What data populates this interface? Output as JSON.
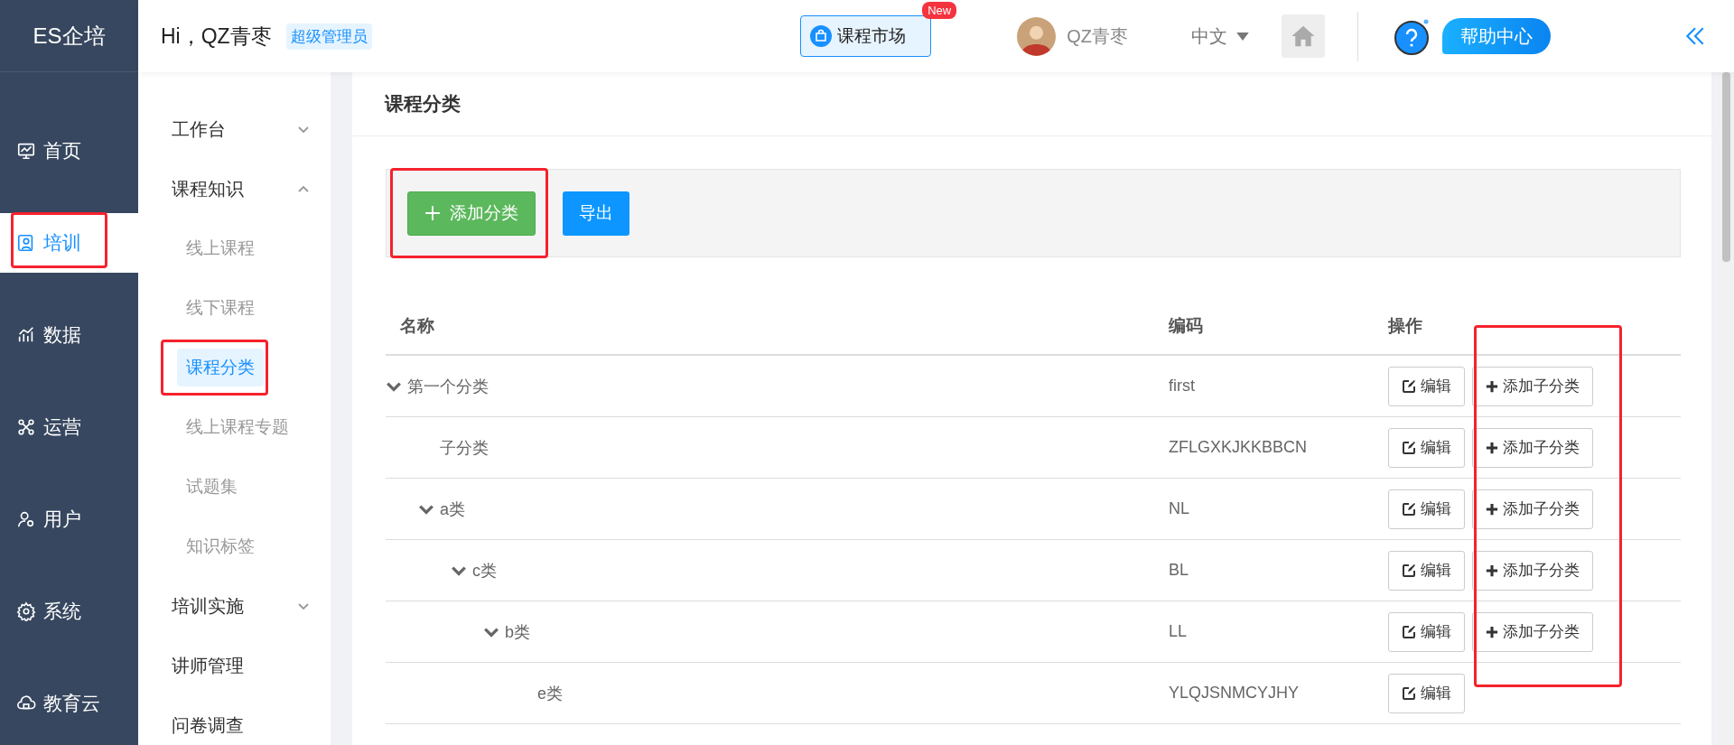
{
  "logo": "ES企培",
  "nav": [
    {
      "label": "首页",
      "selected": false,
      "highlighted": false
    },
    {
      "label": "培训",
      "selected": true,
      "highlighted": true
    },
    {
      "label": "数据",
      "selected": false,
      "highlighted": false
    },
    {
      "label": "运营",
      "selected": false,
      "highlighted": false
    },
    {
      "label": "用户",
      "selected": false,
      "highlighted": false
    },
    {
      "label": "系统",
      "selected": false,
      "highlighted": false
    },
    {
      "label": "教育云",
      "selected": false,
      "highlighted": false
    }
  ],
  "header": {
    "greeting": "Hi，QZ青枣",
    "role_badge": "超级管理员",
    "market_button": "课程市场",
    "new_badge": "New",
    "user_name": "QZ青枣",
    "language": "中文",
    "help_button": "帮助中心"
  },
  "submenu": [
    {
      "label": "工作台",
      "expandable": true,
      "expanded": false
    },
    {
      "label": "课程知识",
      "expandable": true,
      "expanded": true,
      "children": [
        {
          "label": "线上课程",
          "selected": false,
          "highlighted": false
        },
        {
          "label": "线下课程",
          "selected": false,
          "highlighted": false
        },
        {
          "label": "课程分类",
          "selected": true,
          "highlighted": true
        },
        {
          "label": "线上课程专题",
          "selected": false,
          "highlighted": false
        },
        {
          "label": "试题集",
          "selected": false,
          "highlighted": false
        },
        {
          "label": "知识标签",
          "selected": false,
          "highlighted": false
        }
      ]
    },
    {
      "label": "培训实施",
      "expandable": true,
      "expanded": false
    },
    {
      "label": "讲师管理",
      "expandable": false
    },
    {
      "label": "问卷调查",
      "expandable": false
    }
  ],
  "page_title": "课程分类",
  "toolbar": {
    "add_button": {
      "label": "添加分类",
      "highlighted": true
    },
    "export_button": "导出"
  },
  "table": {
    "columns": [
      "名称",
      "编码",
      "操作"
    ],
    "actions_highlighted": true,
    "rows": [
      {
        "name": "第一个分类",
        "code": "first",
        "expanded": true,
        "actions": [
          {
            "kind": "edit",
            "label": "编辑"
          },
          {
            "kind": "add",
            "label": "添加子分类"
          }
        ],
        "children": [
          {
            "name": "子分类",
            "code": "ZFLGXKJKKBBCN",
            "actions": [
              {
                "kind": "edit",
                "label": "编辑"
              },
              {
                "kind": "add",
                "label": "添加子分类"
              }
            ]
          },
          {
            "name": "a类",
            "code": "NL",
            "expanded": true,
            "actions": [
              {
                "kind": "edit",
                "label": "编辑"
              },
              {
                "kind": "add",
                "label": "添加子分类"
              }
            ],
            "children": [
              {
                "name": "c类",
                "code": "BL",
                "expanded": true,
                "actions": [
                  {
                    "kind": "edit",
                    "label": "编辑"
                  },
                  {
                    "kind": "add",
                    "label": "添加子分类"
                  }
                ],
                "children": [
                  {
                    "name": "b类",
                    "code": "LL",
                    "expanded": true,
                    "actions": [
                      {
                        "kind": "edit",
                        "label": "编辑"
                      },
                      {
                        "kind": "add",
                        "label": "添加子分类"
                      }
                    ],
                    "children": [
                      {
                        "name": "e类",
                        "code": "YLQJSNMCYJHY",
                        "actions": [
                          {
                            "kind": "edit",
                            "label": "编辑"
                          }
                        ]
                      }
                    ]
                  }
                ]
              }
            ]
          }
        ]
      }
    ]
  }
}
